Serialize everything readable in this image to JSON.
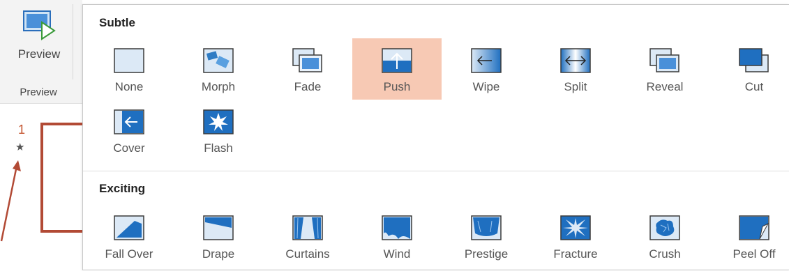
{
  "ribbon": {
    "preview_label": "Preview",
    "group_label": "Preview",
    "preview_icon": "preview-play-icon"
  },
  "slide": {
    "number": "1",
    "anim_icon": "★",
    "accent_color": "#b24a35"
  },
  "gallery": {
    "selected": "Push",
    "highlight_color": "#f7c9b4",
    "sections": [
      {
        "title": "Subtle",
        "items": [
          {
            "label": "None",
            "icon": "none-transition-icon"
          },
          {
            "label": "Morph",
            "icon": "morph-transition-icon"
          },
          {
            "label": "Fade",
            "icon": "fade-transition-icon"
          },
          {
            "label": "Push",
            "icon": "push-transition-icon"
          },
          {
            "label": "Wipe",
            "icon": "wipe-transition-icon"
          },
          {
            "label": "Split",
            "icon": "split-transition-icon"
          },
          {
            "label": "Reveal",
            "icon": "reveal-transition-icon"
          },
          {
            "label": "Cut",
            "icon": "cut-transition-icon"
          },
          {
            "label": "Cover",
            "icon": "cover-transition-icon"
          },
          {
            "label": "Flash",
            "icon": "flash-transition-icon"
          }
        ]
      },
      {
        "title": "Exciting",
        "items": [
          {
            "label": "Fall Over",
            "icon": "fall-over-transition-icon"
          },
          {
            "label": "Drape",
            "icon": "drape-transition-icon"
          },
          {
            "label": "Curtains",
            "icon": "curtains-transition-icon"
          },
          {
            "label": "Wind",
            "icon": "wind-transition-icon"
          },
          {
            "label": "Prestige",
            "icon": "prestige-transition-icon"
          },
          {
            "label": "Fracture",
            "icon": "fracture-transition-icon"
          },
          {
            "label": "Crush",
            "icon": "crush-transition-icon"
          },
          {
            "label": "Peel Off",
            "icon": "peel-off-transition-icon"
          }
        ]
      }
    ]
  }
}
